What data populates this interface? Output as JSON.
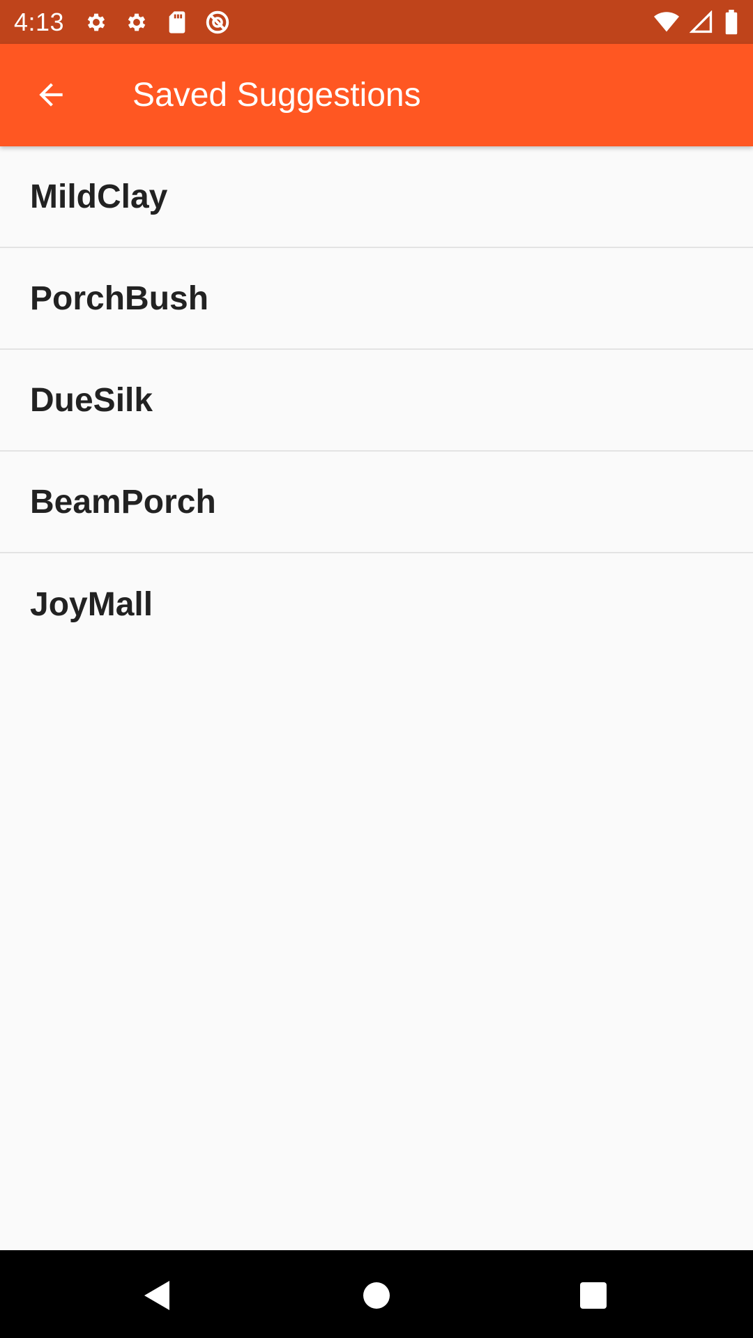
{
  "status_bar": {
    "time": "4:13",
    "left_icons": [
      "settings-icon",
      "settings-icon",
      "sd-card-icon",
      "no-sync-icon"
    ],
    "right_icons": [
      "wifi-icon",
      "signal-icon",
      "battery-icon"
    ]
  },
  "app_bar": {
    "title": "Saved Suggestions",
    "background": "#ff5722",
    "back_icon": "arrow-back-icon"
  },
  "saved_list": {
    "items": [
      {
        "label": "MildClay"
      },
      {
        "label": "PorchBush"
      },
      {
        "label": "DueSilk"
      },
      {
        "label": "BeamPorch"
      },
      {
        "label": "JoyMall"
      }
    ]
  },
  "nav_bar": {
    "buttons": [
      "back-triangle-icon",
      "home-circle-icon",
      "recents-square-icon"
    ]
  },
  "colors": {
    "status_bar": "#bf441b",
    "app_bar": "#ff5722",
    "background": "#fafafa",
    "divider": "#e3e3e3",
    "text": "#222222"
  }
}
